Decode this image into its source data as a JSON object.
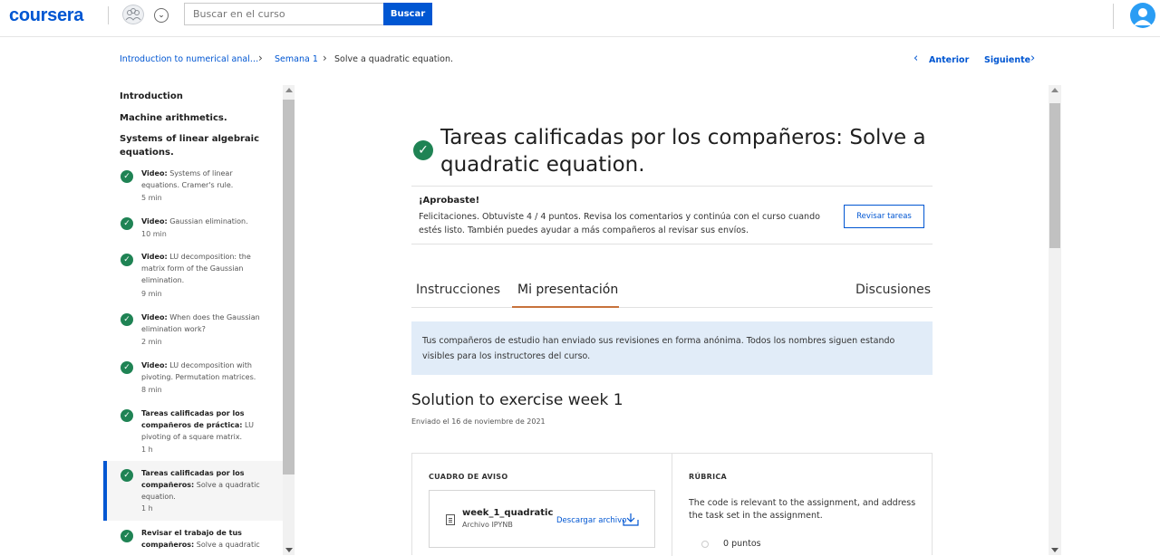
{
  "header": {
    "logo": "coursera",
    "search_placeholder": "Buscar en el curso",
    "search_button": "Buscar"
  },
  "breadcrumb": {
    "course": "Introduction to numerical anal…",
    "week": "Semana 1",
    "current": "Solve a quadratic equation."
  },
  "nav": {
    "prev": "Anterior",
    "next": "Siguiente"
  },
  "sidebar": {
    "modules": [
      "Introduction",
      "Machine arithmetics.",
      "Systems of linear algebraic equations."
    ],
    "items": [
      {
        "prefix": "Video:",
        "label": "Systems of linear equations. Cramer's rule.",
        "duration": "5 min"
      },
      {
        "prefix": "Video:",
        "label": "Gaussian elimination.",
        "duration": "10 min"
      },
      {
        "prefix": "Video:",
        "label": "LU decomposition: the matrix form of the Gaussian elimination.",
        "duration": "9 min"
      },
      {
        "prefix": "Video:",
        "label": "When does the Gaussian elimination work?",
        "duration": "2 min"
      },
      {
        "prefix": "Video:",
        "label": "LU decomposition with pivoting. Permutation matrices.",
        "duration": "8 min"
      },
      {
        "prefix": "Tareas calificadas por los compañeros de práctica:",
        "label": "LU pivoting of a square matrix.",
        "duration": "1 h"
      },
      {
        "prefix": "Tareas calificadas por los compañeros:",
        "label": "Solve a quadratic equation.",
        "duration": "1 h"
      },
      {
        "prefix": "Revisar el trabajo de tus compañeros:",
        "label": "Solve a quadratic",
        "duration": ""
      }
    ]
  },
  "main": {
    "title": "Tareas calificadas por los compañeros: Solve a quadratic equation.",
    "pass_heading": "¡Aprobaste!",
    "pass_text": "Felicitaciones. Obtuviste 4 / 4 puntos. Revisa los comentarios y continúa con el curso cuando estés listo. También puedes ayudar a más compañeros al revisar sus envíos.",
    "review_button": "Revisar tareas",
    "tabs": [
      "Instrucciones",
      "Mi presentación",
      "Discusiones"
    ],
    "active_tab": "Mi presentación",
    "notice": "Tus compañeros de estudio han enviado sus revisiones en forma anónima. Todos los nombres siguen estando visibles para los instructores del curso.",
    "submission_title": "Solution to exercise week 1",
    "submission_date": "Enviado el 16 de noviembre de 2021",
    "box_label": "CUADRO DE AVISO",
    "file_name": "week_1_quadratic",
    "file_type": "Archivo IPYNB",
    "download_label": "Descargar archivo",
    "rubric_label": "RÚBRICA",
    "rubric_text": "The code is relevant to the assignment, and address the task set in the assignment.",
    "rubric_option": "0 puntos"
  },
  "colors": {
    "brand": "#0056d2",
    "success": "#1f8354",
    "tab_accent": "#c7723c",
    "notice_bg": "#e1ecf8"
  }
}
